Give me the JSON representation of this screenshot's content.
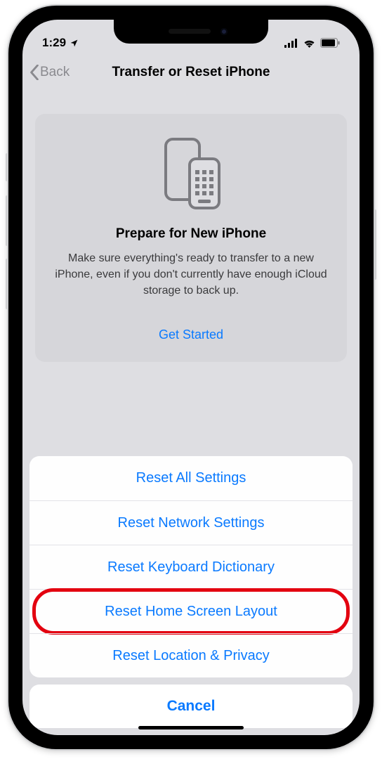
{
  "statusbar": {
    "time": "1:29"
  },
  "nav": {
    "back": "Back",
    "title": "Transfer or Reset iPhone"
  },
  "card": {
    "title": "Prepare for New iPhone",
    "desc": "Make sure everything's ready to transfer to a new iPhone, even if you don't currently have enough iCloud storage to back up.",
    "cta": "Get Started"
  },
  "sheet": {
    "items": [
      "Reset All Settings",
      "Reset Network Settings",
      "Reset Keyboard Dictionary",
      "Reset Home Screen Layout",
      "Reset Location & Privacy"
    ],
    "highlighted_index": 3,
    "cancel": "Cancel"
  }
}
